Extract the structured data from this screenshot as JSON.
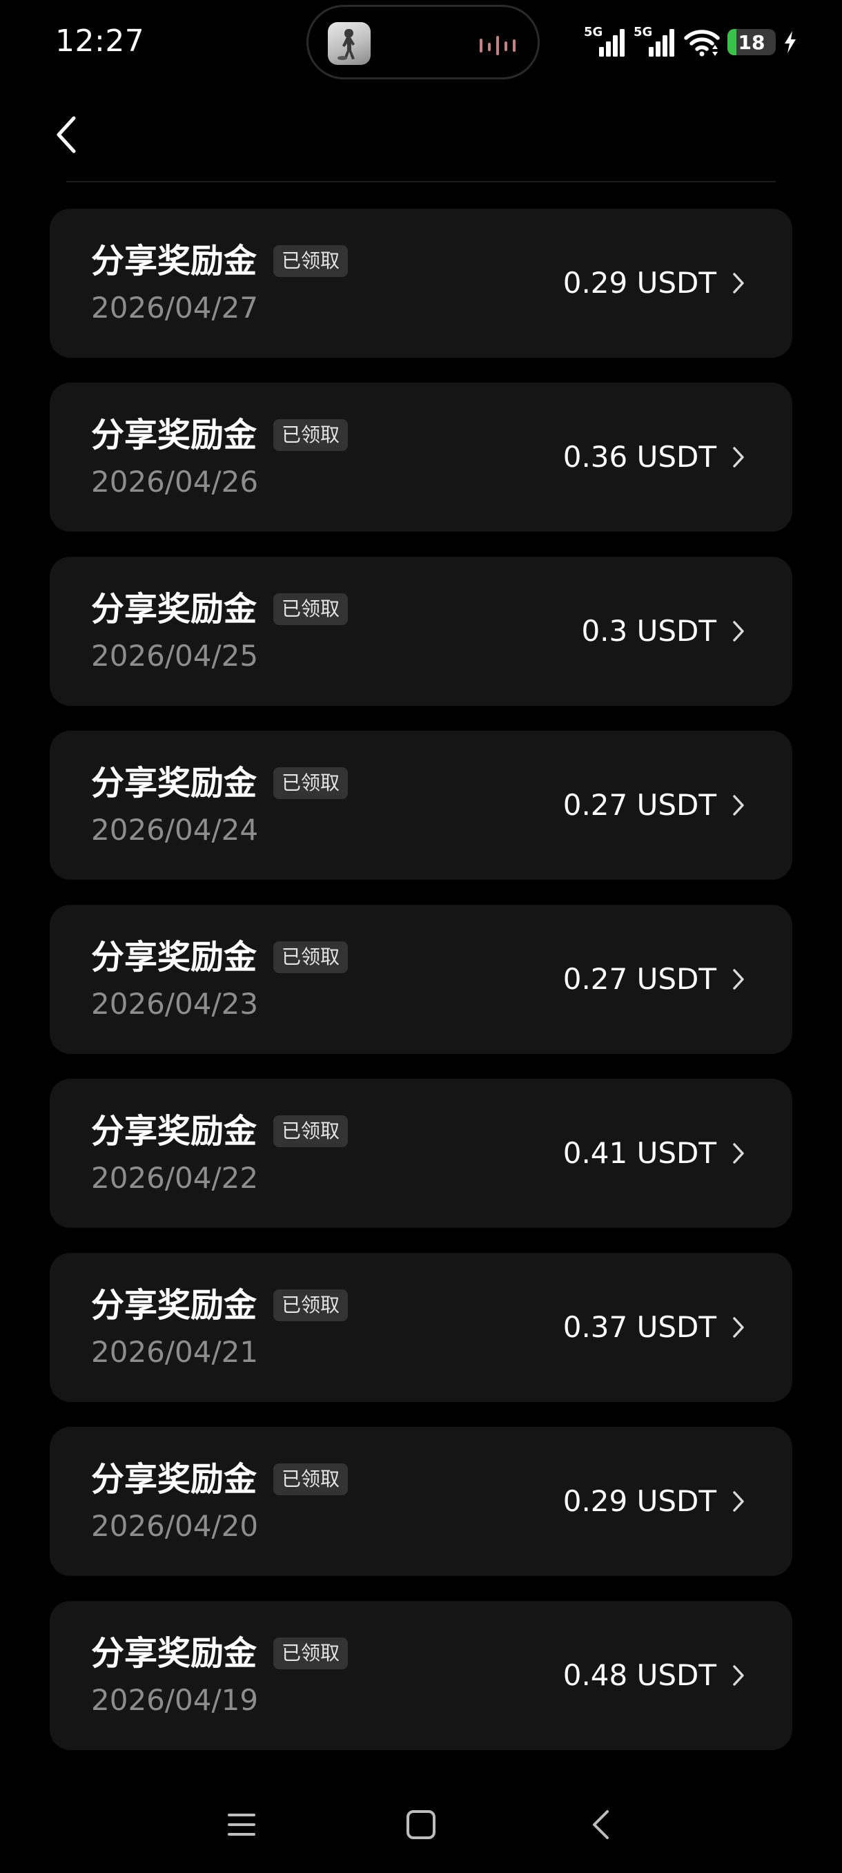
{
  "status_bar": {
    "time": "12:27",
    "signal_1": "5G",
    "signal_2": "5G",
    "battery_level": "18",
    "battery_fraction": 0.18,
    "colors": {
      "battery": "#38c24a",
      "wave": "#c98080"
    }
  },
  "header": {
    "back_icon": "chevron-left-icon"
  },
  "rewards": [
    {
      "title": "分享奖励金",
      "badge": "已领取",
      "date": "2026/04/27",
      "amount": "0.29 USDT"
    },
    {
      "title": "分享奖励金",
      "badge": "已领取",
      "date": "2026/04/26",
      "amount": "0.36 USDT"
    },
    {
      "title": "分享奖励金",
      "badge": "已领取",
      "date": "2026/04/25",
      "amount": "0.3 USDT"
    },
    {
      "title": "分享奖励金",
      "badge": "已领取",
      "date": "2026/04/24",
      "amount": "0.27 USDT"
    },
    {
      "title": "分享奖励金",
      "badge": "已领取",
      "date": "2026/04/23",
      "amount": "0.27 USDT"
    },
    {
      "title": "分享奖励金",
      "badge": "已领取",
      "date": "2026/04/22",
      "amount": "0.41 USDT"
    },
    {
      "title": "分享奖励金",
      "badge": "已领取",
      "date": "2026/04/21",
      "amount": "0.37 USDT"
    },
    {
      "title": "分享奖励金",
      "badge": "已领取",
      "date": "2026/04/20",
      "amount": "0.29 USDT"
    },
    {
      "title": "分享奖励金",
      "badge": "已领取",
      "date": "2026/04/19",
      "amount": "0.48 USDT"
    }
  ],
  "nav_bar": {
    "icons": [
      "menu-icon",
      "home-icon",
      "back-icon"
    ]
  }
}
